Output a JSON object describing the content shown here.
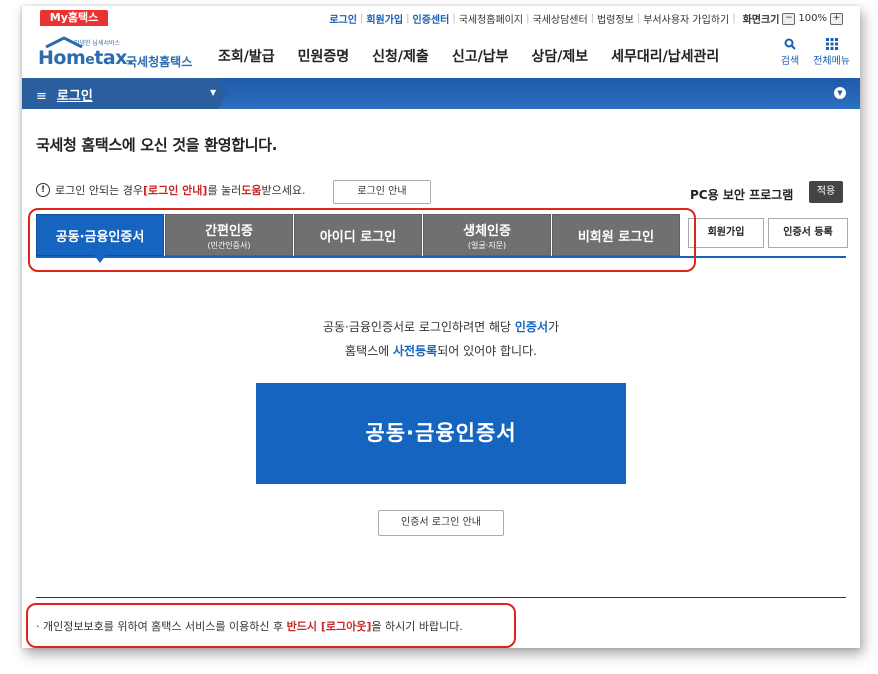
{
  "top": {
    "my_tab": "My홈택스",
    "links": [
      "로그인",
      "회원가입",
      "인증센터",
      "국세청홈페이지",
      "국세상담센터",
      "법령정보",
      "부서사용자 가입하기"
    ],
    "zoom_label": "화면크기",
    "zoom_minus": "−",
    "zoom_value": "100%",
    "zoom_plus": "+"
  },
  "header": {
    "logo_small": "안녕한 납세서비스",
    "logo_name_a": "Hom",
    "logo_name_b": "e",
    "logo_name_c": "tax.",
    "logo_kor": "국세청홈택스",
    "menu": [
      "조회/발급",
      "민원증명",
      "신청/제출",
      "신고/납부",
      "상담/제보",
      "세무대리/납세관리"
    ],
    "search_label": "검색",
    "allmenu_label": "전체메뉴"
  },
  "navbar": {
    "menu_icon": "≡",
    "title": "로그인",
    "caret": "▼",
    "right_icon": "▼"
  },
  "main": {
    "welcome": "국세청 홈택스에 오신 것을 환영합니다.",
    "notice_icon": "!",
    "notice_prefix": "로그인 안되는 경우 ",
    "notice_red1": "[로그인 안내]",
    "notice_mid": "를 눌러 ",
    "notice_red2": "도움",
    "notice_suffix": "받으세요.",
    "login_guide_button": "로그인 안내",
    "pc_security": "PC용 보안 프로그램",
    "apply_button": "적용",
    "tabs": [
      {
        "label": "공동·금융인증서",
        "sub": ""
      },
      {
        "label": "간편인증",
        "sub": "(민간인증서)"
      },
      {
        "label": "아이디 로그인",
        "sub": ""
      },
      {
        "label": "생체인증",
        "sub": "(얼굴·지문)"
      },
      {
        "label": "비회원 로그인",
        "sub": ""
      }
    ],
    "join_button": "회원가입",
    "cert_register_button": "인증서 등록",
    "desc1_a": "공동·금융인증서로 로그인하려면 해당 ",
    "desc1_b": "인증서",
    "desc1_c": "가",
    "desc2_a": "홈택스에 ",
    "desc2_b": "사전등록",
    "desc2_c": "되어 있어야 합니다.",
    "big_button": "공동·금융인증서",
    "cert_login_guide_button": "인증서 로그인 안내",
    "privacy_prefix": "· 개인정보보호를 위하여 홈택스 서비스를 이용하신 후 ",
    "privacy_red": "반드시 [로그아웃]",
    "privacy_suffix": "을 하시기 바랍니다."
  },
  "colors": {
    "brand_blue": "#1565c0",
    "nav_blue": "#2a5e9f",
    "highlight_red": "#e0241c",
    "tab_gray": "#707070"
  }
}
